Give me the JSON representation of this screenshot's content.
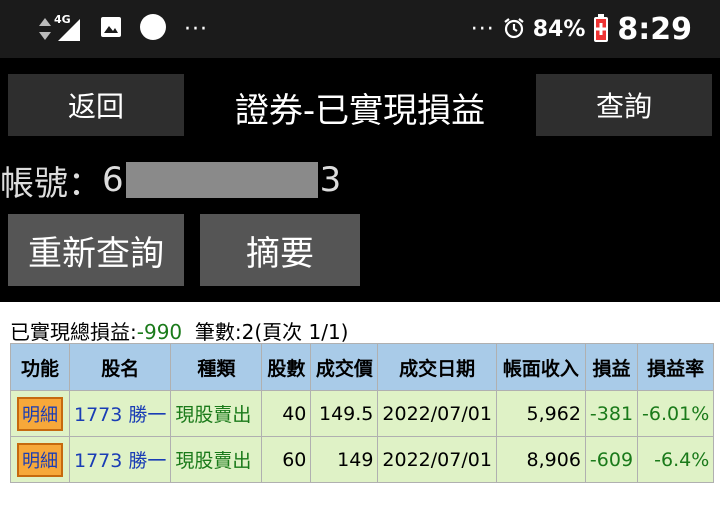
{
  "status_bar": {
    "signal": "4G",
    "more": "···",
    "more_right": "···",
    "battery": "84%",
    "time": "8:29"
  },
  "header": {
    "back_label": "返回",
    "title": "證券-已實現損益",
    "query_label": "查詢"
  },
  "account": {
    "label": "帳號：",
    "prefix": "6",
    "suffix": "3"
  },
  "actions": {
    "requery_label": "重新查詢",
    "summary_label": "摘要"
  },
  "summary": {
    "total_label": "已實現總損益:",
    "total_value": "-990",
    "count_text": "筆數:2(頁次 1/1)"
  },
  "table": {
    "headers": [
      "功能",
      "股名",
      "種類",
      "股數",
      "成交價",
      "成交日期",
      "帳面收入",
      "損益",
      "損益率"
    ],
    "rows": [
      {
        "action": "明細",
        "stock": "1773 勝一",
        "type": "現股賣出",
        "shares": "40",
        "price": "149.5",
        "date": "2022/07/01",
        "income": "5,962",
        "pnl": "-381",
        "rate": "-6.01%"
      },
      {
        "action": "明細",
        "stock": "1773 勝一",
        "type": "現股賣出",
        "shares": "60",
        "price": "149",
        "date": "2022/07/01",
        "income": "8,906",
        "pnl": "-609",
        "rate": "-6.4%"
      }
    ]
  }
}
